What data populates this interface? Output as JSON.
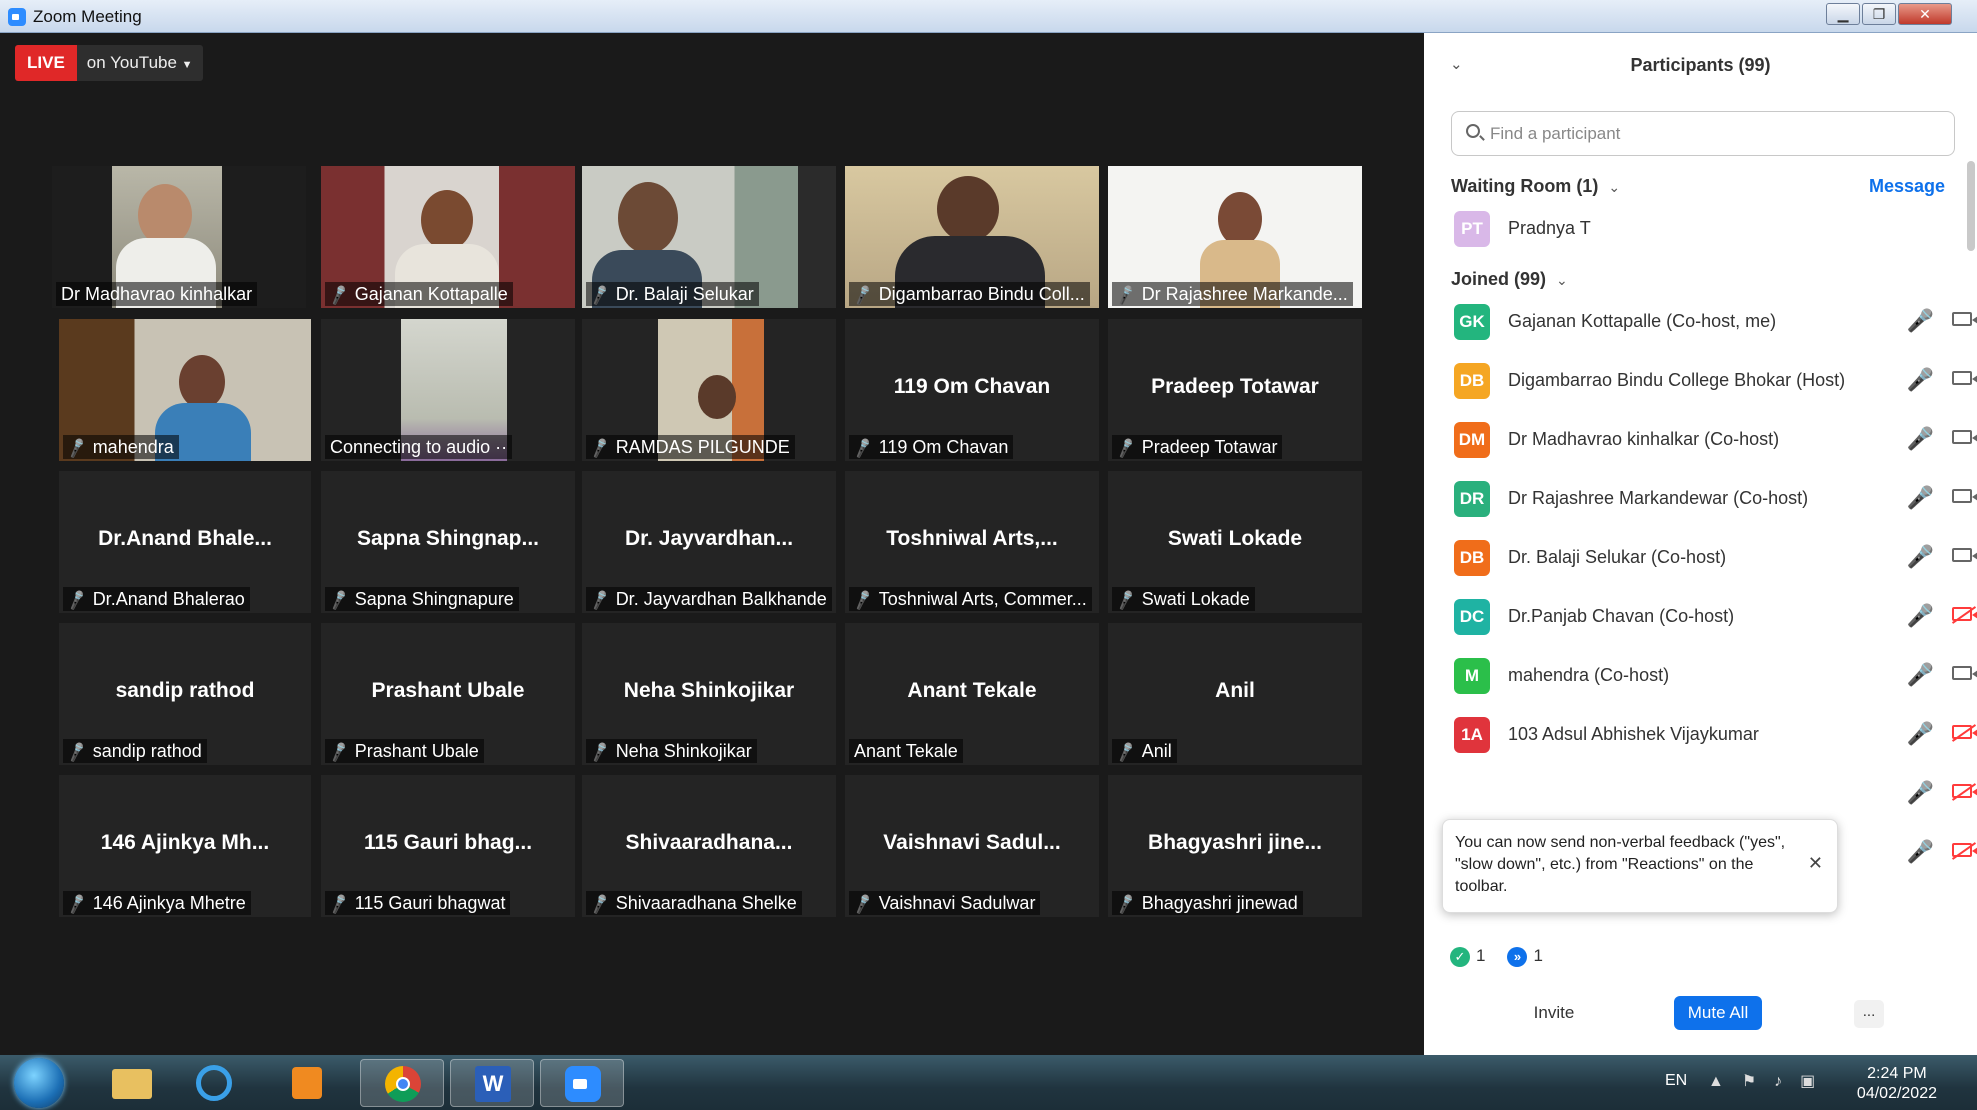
{
  "window": {
    "title": "Zoom Meeting"
  },
  "live": {
    "badge": "LIVE",
    "platform": "on YouTube"
  },
  "tiles": [
    {
      "name": "Dr Madhavrao kinhalkar",
      "big": "",
      "muted": false,
      "video": true,
      "speaker": true
    },
    {
      "name": "Gajanan Kottapalle",
      "big": "",
      "muted": true,
      "video": true
    },
    {
      "name": "Dr. Balaji Selukar",
      "big": "",
      "muted": true,
      "video": true
    },
    {
      "name": "Digambarrao Bindu Coll...",
      "big": "",
      "muted": true,
      "video": true
    },
    {
      "name": "Dr Rajashree Markande...",
      "big": "",
      "muted": true,
      "video": true
    },
    {
      "name": "mahendra",
      "big": "",
      "muted": true,
      "video": true
    },
    {
      "name": "Connecting to audio",
      "big": "",
      "muted": false,
      "video": true
    },
    {
      "name": "RAMDAS PILGUNDE",
      "big": "",
      "muted": true,
      "video": true
    },
    {
      "name": "119 Om Chavan",
      "big": "119 Om Chavan",
      "muted": true,
      "video": false
    },
    {
      "name": "Pradeep Totawar",
      "big": "Pradeep Totawar",
      "muted": true,
      "video": false
    },
    {
      "name": "Dr.Anand Bhalerao",
      "big": "Dr.Anand  Bhale...",
      "muted": true,
      "video": false
    },
    {
      "name": "Sapna Shingnapure",
      "big": "Sapna  Shingnap...",
      "muted": true,
      "video": false
    },
    {
      "name": "Dr. Jayvardhan Balkhande",
      "big": "Dr.  Jayvardhan...",
      "muted": true,
      "video": false
    },
    {
      "name": "Toshniwal Arts, Commer...",
      "big": "Toshniwal  Arts,...",
      "muted": true,
      "video": false
    },
    {
      "name": "Swati Lokade",
      "big": "Swati Lokade",
      "muted": true,
      "video": false
    },
    {
      "name": "sandip rathod",
      "big": "sandip rathod",
      "muted": true,
      "video": false
    },
    {
      "name": "Prashant Ubale",
      "big": "Prashant Ubale",
      "muted": true,
      "video": false
    },
    {
      "name": "Neha Shinkojikar",
      "big": "Neha Shinkojikar",
      "muted": true,
      "video": false
    },
    {
      "name": "Anant Tekale",
      "big": "Anant Tekale",
      "muted": false,
      "video": false
    },
    {
      "name": "Anil",
      "big": "Anil",
      "muted": true,
      "video": false
    },
    {
      "name": "146 Ajinkya Mhetre",
      "big": "146  Ajinkya  Mh...",
      "muted": true,
      "video": false
    },
    {
      "name": "115 Gauri bhagwat",
      "big": "115  Gauri  bhag...",
      "muted": true,
      "video": false
    },
    {
      "name": "Shivaaradhana Shelke",
      "big": "Shivaaradhana...",
      "muted": true,
      "video": false
    },
    {
      "name": "Vaishnavi Sadulwar",
      "big": "Vaishnavi  Sadul...",
      "muted": true,
      "video": false
    },
    {
      "name": "Bhagyashri jinewad",
      "big": "Bhagyashri  jine...",
      "muted": true,
      "video": false
    }
  ],
  "panel": {
    "title": "Participants (99)",
    "search_placeholder": "Find a participant",
    "waiting_room_label": "Waiting Room (1)",
    "message_link": "Message",
    "waiting": [
      {
        "initials": "PT",
        "name": "Pradnya T",
        "color": "#d9b8e8"
      }
    ],
    "joined_label": "Joined (99)",
    "joined": [
      {
        "initials": "GK",
        "name": "Gajanan Kottapalle (Co-host, me)",
        "color": "#23b57e",
        "mic": "muted",
        "cam": "on"
      },
      {
        "initials": "DB",
        "name": "Digambarrao Bindu College Bhokar (Host)",
        "color": "#f5a623",
        "mic": "muted",
        "cam": "on"
      },
      {
        "initials": "DM",
        "name": "Dr Madhavrao kinhalkar (Co-host)",
        "color": "#f06d1a",
        "mic": "on",
        "cam": "on"
      },
      {
        "initials": "DR",
        "name": "Dr Rajashree Markandewar (Co-host)",
        "color": "#2ab07d",
        "mic": "muted",
        "cam": "on"
      },
      {
        "initials": "DB",
        "name": "Dr. Balaji Selukar (Co-host)",
        "color": "#f06d1a",
        "mic": "muted",
        "cam": "on"
      },
      {
        "initials": "DC",
        "name": "Dr.Panjab Chavan (Co-host)",
        "color": "#1fb3a3",
        "mic": "muted",
        "cam": "off"
      },
      {
        "initials": "M",
        "name": "mahendra (Co-host)",
        "color": "#2bbf4a",
        "mic": "muted",
        "cam": "on"
      },
      {
        "initials": "1A",
        "name": "103 Adsul Abhishek Vijaykumar",
        "color": "#e0343c",
        "mic": "muted",
        "cam": "off"
      }
    ],
    "tooltip_text": "You can now send non-verbal feedback (\"yes\", \"slow down\", etc.) from \"Reactions\" on the toolbar.",
    "stat_yes_count": "1",
    "stat_go_count": "1",
    "invite_label": "Invite",
    "mute_all_label": "Mute All",
    "more_label": "..."
  },
  "taskbar": {
    "lang": "EN",
    "time": "2:24 PM",
    "date": "04/02/2022"
  },
  "colors": {
    "accent": "#0e71eb",
    "live": "#e02828",
    "speaker_outline": "#c8e040",
    "muted_red": "#ff3b3b"
  }
}
